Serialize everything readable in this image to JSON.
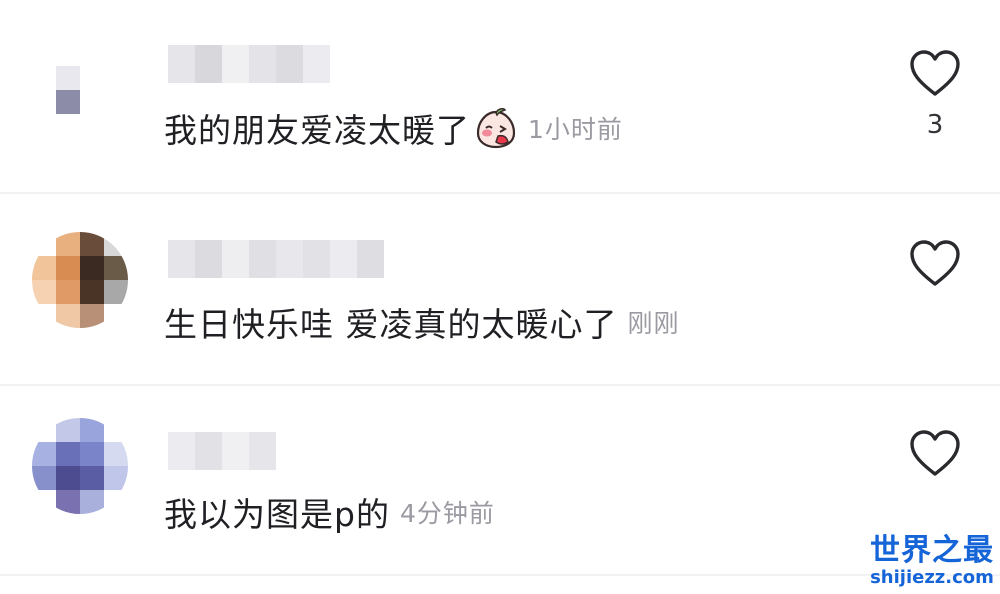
{
  "comments": [
    {
      "text": "我的朋友爱凌太暖了",
      "emoji": "blushing-peach-emoji",
      "time": "1小时前",
      "like_count": "3",
      "avatar_colors": [
        "#ffffff",
        "#ffffff",
        "#ffffff",
        "#ffffff",
        "#ffffff",
        "#e8e8ee",
        "#ffffff",
        "#ffffff",
        "#ffffff",
        "#8c8ca8",
        "#ffffff",
        "#ffffff",
        "#ffffff",
        "#ffffff",
        "#ffffff",
        "#ffffff"
      ],
      "name_colors": [
        "#e6e6ea",
        "#d8d8dc",
        "#f0f0f2",
        "#e4e4e8",
        "#dcdce0",
        "#ececf0"
      ]
    },
    {
      "text": "生日快乐哇 爱凌真的太暖心了",
      "time": "刚刚",
      "like_count": "",
      "avatar_colors": [
        "#ffffff",
        "#e8b07e",
        "#6a4c3a",
        "#d8d8d8",
        "#f2c49a",
        "#d88c52",
        "#3a2a22",
        "#6a5a48",
        "#f6d2b2",
        "#e09a66",
        "#4a3426",
        "#a8a8a8",
        "#ffffff",
        "#f0c8a6",
        "#b89078",
        "#ffffff"
      ],
      "name_colors": [
        "#e6e6ea",
        "#dcdce0",
        "#eeeef0",
        "#e0e0e4",
        "#e8e8ec",
        "#e2e2e6",
        "#ececf0",
        "#dedee2"
      ]
    },
    {
      "text": "我以为图是p的",
      "time": "4分钟前",
      "like_count": "",
      "avatar_colors": [
        "#ffffff",
        "#c4c8e8",
        "#9aa4dc",
        "#ffffff",
        "#a8b2e2",
        "#6a70b8",
        "#7a84c8",
        "#d6daf0",
        "#8890cc",
        "#4e4c90",
        "#5a5ca4",
        "#c0c6ea",
        "#ffffff",
        "#7a72b0",
        "#aab0dc",
        "#ffffff"
      ],
      "name_colors": [
        "#ececf0",
        "#e2e2e6",
        "#f0f0f2",
        "#e6e6ea"
      ]
    }
  ],
  "icons": {
    "like": "heart-outline-icon"
  },
  "watermark": {
    "main": "世界之最",
    "sub": "shijiezz.com",
    "color": "#1565d8"
  }
}
